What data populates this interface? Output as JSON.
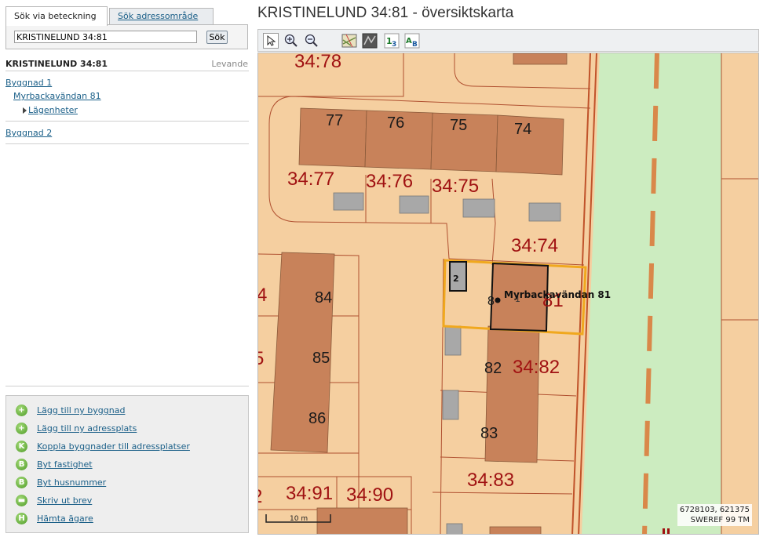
{
  "search": {
    "tab_active": "Sök via beteckning",
    "tab_inactive": "Sök adressområde",
    "input_value": "KRISTINELUND 34:81",
    "button_label": "Sök"
  },
  "property": {
    "title": "KRISTINELUND 34:81",
    "status": "Levande"
  },
  "tree": {
    "building1": "Byggnad 1",
    "address": "Myrbackavändan 81",
    "apartments": "Lägenheter",
    "building2": "Byggnad 2"
  },
  "actions": [
    {
      "label": "Lägg till ny byggnad",
      "icon": "plus"
    },
    {
      "label": "Lägg till ny adressplats",
      "icon": "plus"
    },
    {
      "label": "Koppla byggnader till adressplatser",
      "icon": "K"
    },
    {
      "label": "Byt fastighet",
      "icon": "B"
    },
    {
      "label": "Byt husnummer",
      "icon": "B"
    },
    {
      "label": "Skriv ut brev",
      "icon": "printer"
    },
    {
      "label": "Hämta ägare",
      "icon": "H"
    }
  ],
  "map": {
    "title": "KRISTINELUND 34:81 - översiktskarta",
    "parcels": [
      "34:78",
      "34:77",
      "34:76",
      "34:75",
      "34:74",
      "34:82",
      "34:83",
      "34:91",
      "34:90",
      "4",
      "5",
      "2",
      "81"
    ],
    "house_numbers": [
      "77",
      "76",
      "75",
      "74",
      "84",
      "85",
      "86",
      "82",
      "83",
      "8"
    ],
    "building_numbers": [
      "2",
      "1"
    ],
    "address_label": "Myrbackavändan 81",
    "scale_label": "10 m",
    "coordinates": "6728103, 621375",
    "crs": "SWEREF 99 TM"
  },
  "colors": {
    "parcel_fill": "#f5cfa0",
    "building_fill": "#c8825a",
    "parcel_label": "#a01212",
    "selection": "#f0a81e",
    "park": "#ccecc0",
    "link": "#1a5f88"
  }
}
